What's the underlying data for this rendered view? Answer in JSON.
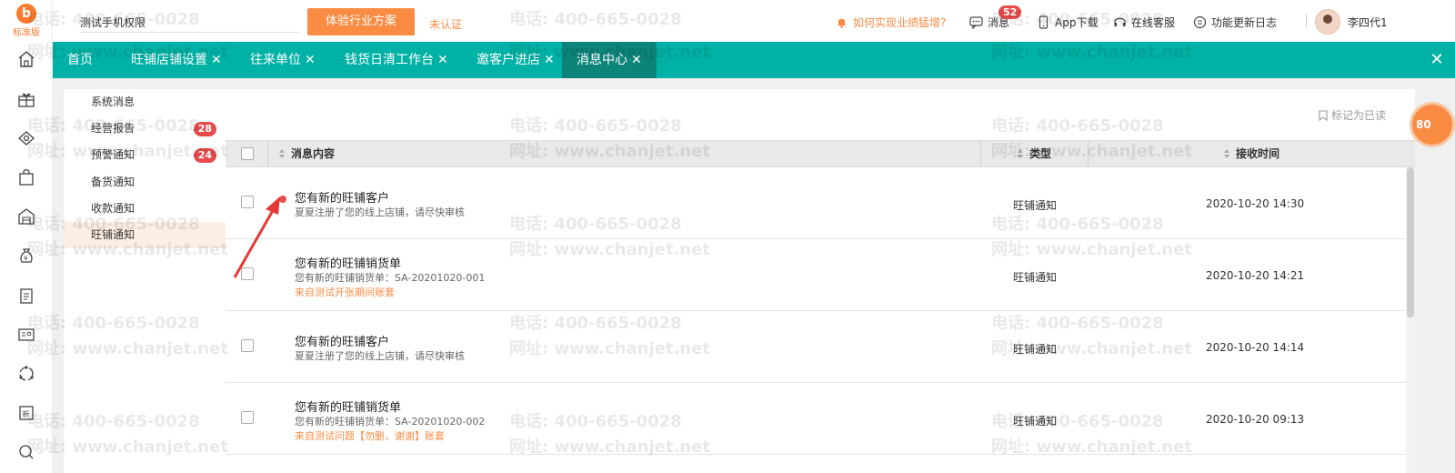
{
  "app": {
    "logo_text": "标准版",
    "logo_mark": "b"
  },
  "header": {
    "company_name": "测试手机权限",
    "plan_button": "体验行业方案",
    "unverified": "未认证",
    "promo_link": "如何实现业绩猛增?",
    "messages_label": "消息",
    "messages_badge": "52",
    "app_download": "App下载",
    "online_support": "在线客服",
    "changelog": "功能更新日志",
    "username": "李四代1"
  },
  "tabs": [
    {
      "label": "首页",
      "closable": false
    },
    {
      "label": "旺铺店铺设置",
      "closable": true
    },
    {
      "label": "往来单位",
      "closable": true
    },
    {
      "label": "钱货日清工作台",
      "closable": true
    },
    {
      "label": "邀客户进店",
      "closable": true
    },
    {
      "label": "消息中心",
      "closable": true,
      "active": true
    }
  ],
  "tab_close_all": "✕",
  "left_menu": {
    "items": [
      {
        "label": "系统消息",
        "badge": ""
      },
      {
        "label": "经营报告",
        "badge": "28"
      },
      {
        "label": "预警通知",
        "badge": "24"
      },
      {
        "label": "备货通知",
        "badge": ""
      },
      {
        "label": "收款通知",
        "badge": ""
      },
      {
        "label": "旺铺通知",
        "badge": "",
        "active": true
      }
    ]
  },
  "panel": {
    "mark_read": "标记为已读",
    "columns": {
      "content": "消息内容",
      "type": "类型",
      "time": "接收时间"
    },
    "rows": [
      {
        "unread": true,
        "title": "您有新的旺铺客户",
        "subtitle": "夏夏注册了您的线上店铺，请尽快审核",
        "source": "",
        "type": "旺铺通知",
        "time": "2020-10-20 14:30"
      },
      {
        "unread": false,
        "title": "您有新的旺铺销货单",
        "subtitle": "您有新的旺铺销货单：SA-20201020-001",
        "source": "来自测试开张期间账套",
        "type": "旺铺通知",
        "time": "2020-10-20 14:21"
      },
      {
        "unread": false,
        "title": "您有新的旺铺客户",
        "subtitle": "夏夏注册了您的线上店铺，请尽快审核",
        "source": "",
        "type": "旺铺通知",
        "time": "2020-10-20 14:14"
      },
      {
        "unread": false,
        "title": "您有新的旺铺销货单",
        "subtitle": "您有新的旺铺销货单：SA-20201020-002",
        "source": "来自测试问题【勿删，谢谢】账套",
        "type": "旺铺通知",
        "time": "2020-10-20 09:13"
      }
    ]
  },
  "float_badge": "80",
  "watermark": {
    "phone": "电话: 400-665-0028",
    "site": "网址: www.chanjet.net"
  },
  "colors": {
    "accent": "#00b1a5",
    "accent_dark": "#0c847a",
    "brand_orange": "#f98b43",
    "badge_red": "#e74c4c"
  }
}
